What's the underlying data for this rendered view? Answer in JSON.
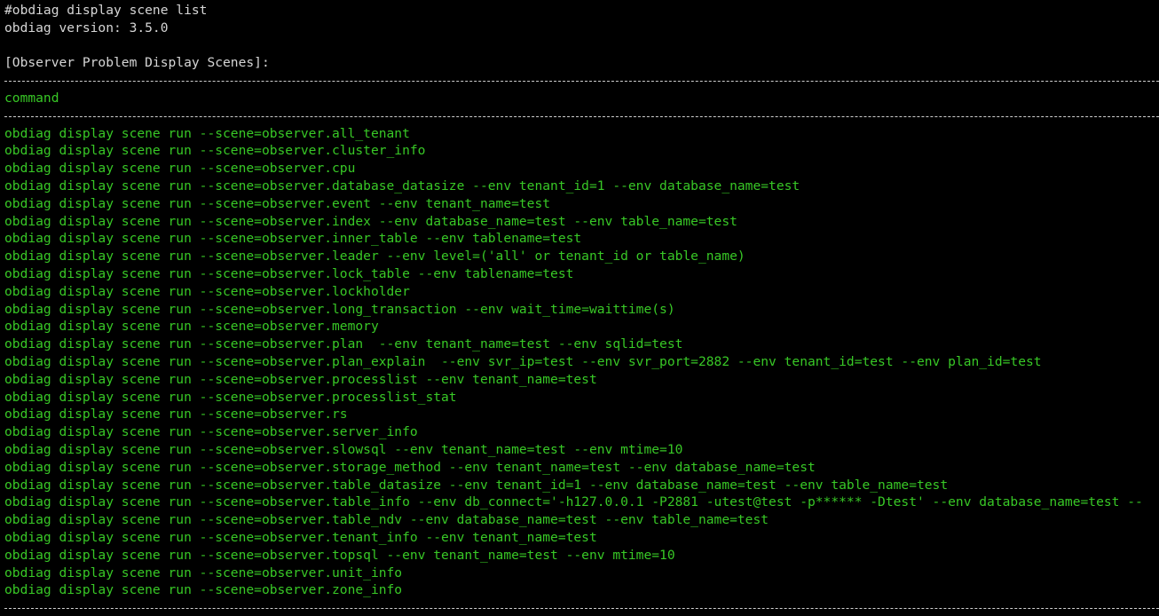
{
  "terminal": {
    "prompt_command": "#obdiag display scene list",
    "version_line": "obdiag version: 3.5.0",
    "section_title": "[Observer Problem Display Scenes]:",
    "column_header": "command",
    "commands": [
      "obdiag display scene run --scene=observer.all_tenant",
      "obdiag display scene run --scene=observer.cluster_info",
      "obdiag display scene run --scene=observer.cpu",
      "obdiag display scene run --scene=observer.database_datasize --env tenant_id=1 --env database_name=test",
      "obdiag display scene run --scene=observer.event --env tenant_name=test",
      "obdiag display scene run --scene=observer.index --env database_name=test --env table_name=test",
      "obdiag display scene run --scene=observer.inner_table --env tablename=test",
      "obdiag display scene run --scene=observer.leader --env level=('all' or tenant_id or table_name)",
      "obdiag display scene run --scene=observer.lock_table --env tablename=test",
      "obdiag display scene run --scene=observer.lockholder",
      "obdiag display scene run --scene=observer.long_transaction --env wait_time=waittime(s)",
      "obdiag display scene run --scene=observer.memory",
      "obdiag display scene run --scene=observer.plan  --env tenant_name=test --env sqlid=test",
      "obdiag display scene run --scene=observer.plan_explain  --env svr_ip=test --env svr_port=2882 --env tenant_id=test --env plan_id=test",
      "obdiag display scene run --scene=observer.processlist --env tenant_name=test",
      "obdiag display scene run --scene=observer.processlist_stat",
      "obdiag display scene run --scene=observer.rs",
      "obdiag display scene run --scene=observer.server_info",
      "obdiag display scene run --scene=observer.slowsql --env tenant_name=test --env mtime=10",
      "obdiag display scene run --scene=observer.storage_method --env tenant_name=test --env database_name=test",
      "obdiag display scene run --scene=observer.table_datasize --env tenant_id=1 --env database_name=test --env table_name=test",
      "obdiag display scene run --scene=observer.table_info --env db_connect='-h127.0.0.1 -P2881 -utest@test -p****** -Dtest' --env database_name=test --",
      "obdiag display scene run --scene=observer.table_ndv --env database_name=test --env table_name=test",
      "obdiag display scene run --scene=observer.tenant_info --env tenant_name=test",
      "obdiag display scene run --scene=observer.topsql --env tenant_name=test --env mtime=10",
      "obdiag display scene run --scene=observer.unit_info",
      "obdiag display scene run --scene=observer.zone_info"
    ]
  },
  "colors": {
    "background": "#000000",
    "text": "#d6d6d6",
    "command_green": "#38c826"
  }
}
